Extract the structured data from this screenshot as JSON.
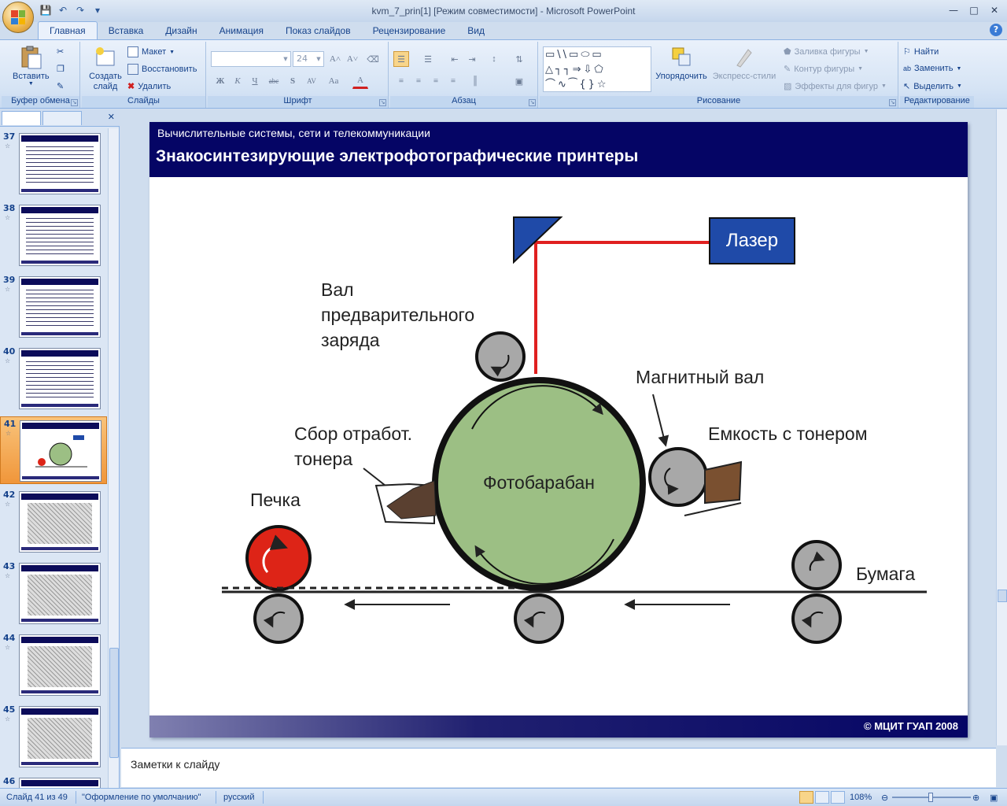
{
  "window": {
    "title": "kvm_7_prin[1] [Режим совместимости] - Microsoft PowerPoint",
    "controls": [
      "minimize",
      "maximize",
      "close"
    ]
  },
  "quick_access": [
    "save-icon",
    "undo-icon",
    "redo-icon",
    "customize-icon"
  ],
  "tabs": [
    {
      "label": "Главная",
      "active": true
    },
    {
      "label": "Вставка"
    },
    {
      "label": "Дизайн"
    },
    {
      "label": "Анимация"
    },
    {
      "label": "Показ слайдов"
    },
    {
      "label": "Рецензирование"
    },
    {
      "label": "Вид"
    }
  ],
  "ribbon": {
    "clipboard": {
      "label": "Буфер обмена",
      "paste": "Вставить"
    },
    "slides": {
      "label": "Слайды",
      "create": "Создать слайд",
      "layout": "Макет",
      "reset": "Восстановить",
      "delete": "Удалить"
    },
    "font": {
      "label": "Шрифт",
      "font_name": "",
      "font_size": "24"
    },
    "paragraph": {
      "label": "Абзац"
    },
    "drawing": {
      "label": "Рисование",
      "arrange": "Упорядочить",
      "quick_styles": "Экспресс-стили",
      "fill": "Заливка фигуры",
      "outline": "Контур фигуры",
      "effects": "Эффекты для фигур"
    },
    "editing": {
      "label": "Редактирование",
      "find": "Найти",
      "replace": "Заменить",
      "select": "Выделить"
    }
  },
  "thumbnails": [
    {
      "num": "37",
      "kind": "text"
    },
    {
      "num": "38",
      "kind": "text"
    },
    {
      "num": "39",
      "kind": "text"
    },
    {
      "num": "40",
      "kind": "text"
    },
    {
      "num": "41",
      "kind": "diagram",
      "selected": true
    },
    {
      "num": "42",
      "kind": "image"
    },
    {
      "num": "43",
      "kind": "image"
    },
    {
      "num": "44",
      "kind": "image"
    },
    {
      "num": "45",
      "kind": "image"
    },
    {
      "num": "46",
      "kind": "text"
    }
  ],
  "slide": {
    "subtitle": "Вычислительные системы, сети и телекоммуникации",
    "title": "Знакосинтезирующие электрофотографические принтеры",
    "footer": "© МЦИТ ГУАП 2008",
    "labels": {
      "laser": "Лазер",
      "precharge_1": "Вал",
      "precharge_2": "предварительного",
      "precharge_3": "заряда",
      "magnetic": "Магнитный вал",
      "toner": "Емкость с тонером",
      "waste_1": "Сбор отработ.",
      "waste_2": "тонера",
      "drum": "Фотобарабан",
      "oven": "Печка",
      "paper": "Бумага"
    },
    "colors": {
      "header": "#050565",
      "laser_beam": "#e02020",
      "laser_box": "#1f4aa8",
      "drum": "#9cbf84",
      "oven": "#dd2417",
      "roller": "#a8a8a8"
    }
  },
  "notes": {
    "placeholder": "Заметки к слайду"
  },
  "status": {
    "slide": "Слайд 41 из 49",
    "theme": "\"Оформление по умолчанию\"",
    "language": "русский",
    "zoom": "108%"
  }
}
